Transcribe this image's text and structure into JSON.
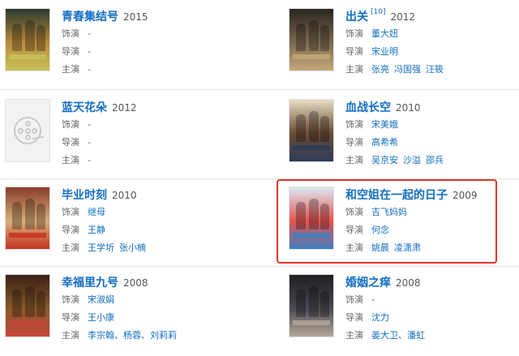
{
  "films": [
    {
      "title": "青春集结号",
      "year": "2015",
      "ref": "",
      "star": {
        "label": "饰演",
        "value": "-"
      },
      "director": {
        "label": "导演",
        "value": "-"
      },
      "cast": {
        "label": "主演",
        "value": "-"
      },
      "poster_colors": [
        "#2b3b2e",
        "#b98a3c",
        "#c7c25a"
      ]
    },
    {
      "title": "出关",
      "year": "2012",
      "ref": "[10]",
      "star": {
        "label": "饰演",
        "value": "董大妞"
      },
      "director": {
        "label": "导演",
        "value": "宋业明"
      },
      "cast": {
        "label": "主演",
        "value": [
          "张亮",
          "冯国强",
          "汪筱"
        ]
      },
      "poster_colors": [
        "#2a2520",
        "#7d6a50",
        "#c5a879"
      ]
    },
    {
      "title": "蓝天花朵",
      "year": "2012",
      "ref": "",
      "star": {
        "label": "饰演",
        "value": "-"
      },
      "director": {
        "label": "导演",
        "value": "-"
      },
      "cast": {
        "label": "主演",
        "value": "-"
      },
      "poster_colors": []
    },
    {
      "title": "血战长空",
      "year": "2010",
      "ref": "",
      "star": {
        "label": "饰演",
        "value": "宋美娥"
      },
      "director": {
        "label": "导演",
        "value": "高希希"
      },
      "cast": {
        "label": "主演",
        "value": [
          "吴京安",
          "沙溢",
          "邵兵"
        ]
      },
      "poster_colors": [
        "#e7dcc4",
        "#6b4a32",
        "#2d3c5a"
      ]
    },
    {
      "title": "毕业时刻",
      "year": "2010",
      "ref": "",
      "star": {
        "label": "饰演",
        "value": "继母"
      },
      "director": {
        "label": "导演",
        "value": "王静"
      },
      "cast": {
        "label": "主演",
        "value": [
          "王学圻",
          "张小楠"
        ]
      },
      "poster_colors": [
        "#8a3b2a",
        "#d9b07a",
        "#c63323"
      ]
    },
    {
      "title": "和空姐在一起的日子",
      "year": "2009",
      "ref": "",
      "star": {
        "label": "饰演",
        "value": "吉飞妈妈"
      },
      "director": {
        "label": "导演",
        "value": "何念"
      },
      "cast": {
        "label": "主演",
        "value": [
          "姚晨",
          "凌潇肃"
        ]
      },
      "poster_colors": [
        "#dbe9f3",
        "#e5534f",
        "#3d7ec2"
      ]
    },
    {
      "title": "幸福里九号",
      "year": "2008",
      "ref": "",
      "star": {
        "label": "饰演",
        "value": "宋淑娟"
      },
      "director": {
        "label": "导演",
        "value": "王小康"
      },
      "cast": {
        "label": "主演",
        "value": "李宗翰、杨蓉、刘莉莉"
      },
      "poster_colors": [
        "#3a2015",
        "#8a5b2a",
        "#c7463a"
      ]
    },
    {
      "title": "婚姻之痒",
      "year": "2008",
      "ref": "",
      "star": {
        "label": "饰演",
        "value": "-"
      },
      "director": {
        "label": "导演",
        "value": "沈力"
      },
      "cast": {
        "label": "主演",
        "value": "姜大卫、潘虹"
      },
      "poster_colors": [
        "#1e1e22",
        "#4b4a54",
        "#b5a89a"
      ]
    }
  ]
}
